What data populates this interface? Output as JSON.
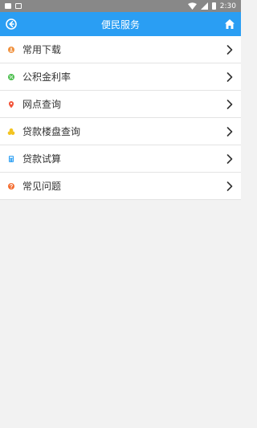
{
  "status_bar": {
    "time": "2:30"
  },
  "header": {
    "title": "便民服务"
  },
  "menu": {
    "items": [
      {
        "label": "常用下载",
        "icon": "download-icon",
        "color": "#f0903c"
      },
      {
        "label": "公积金利率",
        "icon": "rate-icon",
        "color": "#4cbf4e"
      },
      {
        "label": "网点查询",
        "icon": "location-pin-icon",
        "color": "#f2543a"
      },
      {
        "label": "贷款楼盘查询",
        "icon": "building-coins-icon",
        "color": "#f3c421"
      },
      {
        "label": "贷款试算",
        "icon": "calculator-icon",
        "color": "#2a9ef3"
      },
      {
        "label": "常见问题",
        "icon": "question-icon",
        "color": "#f46c2f"
      }
    ]
  },
  "colors": {
    "accent": "#2a9ef3",
    "status_bar": "#888888",
    "background": "#f2f2f2"
  }
}
